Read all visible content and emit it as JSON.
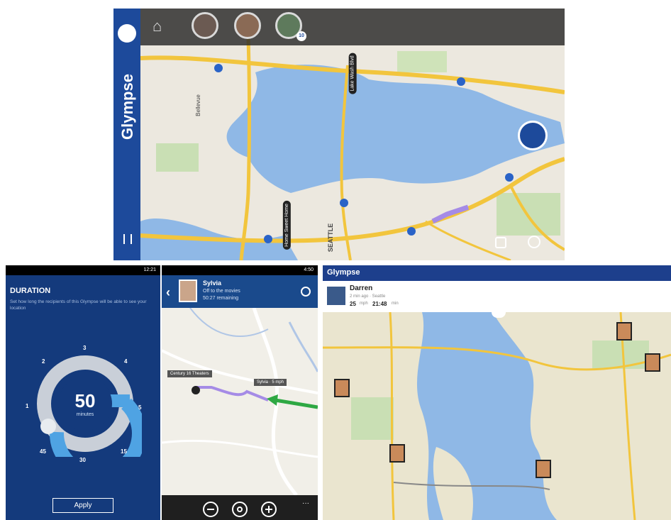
{
  "panel1": {
    "brand": "Glympse",
    "map_labels": [
      "Bellevue",
      "SEATTLE"
    ],
    "pill_labels": [
      "Lake Wash Blvd",
      "Home Sweet Home"
    ],
    "badge_count": "10"
  },
  "panel2": {
    "status_time": "12:21",
    "title": "DURATION",
    "description": "Set how long the recipients of this Glympse will be able to see your location",
    "dial_numbers": [
      "2",
      "3",
      "4",
      "1",
      "5",
      "45",
      "15",
      "30"
    ],
    "value": "50",
    "unit": "minutes",
    "apply_label": "Apply"
  },
  "panel3": {
    "status_time": "4:50",
    "name": "Sylvia",
    "subtitle_line1": "Off to the movies",
    "subtitle_line2": "50:27 remaining",
    "callout_left": "Century 16 Theaters",
    "callout_right": "Sylvia · 5 mph"
  },
  "panel4": {
    "brand": "Glympse",
    "contact_name": "Darren",
    "contact_sub": "2 min ago · Seattle",
    "eta_value": "25",
    "eta_unit": "mph",
    "time_value": "21:48",
    "time_unit": "min"
  },
  "colors": {
    "brand_blue": "#1d4a9b",
    "dark_blue": "#143a7c",
    "route_purple": "#a58be6",
    "route_green": "#2ea843",
    "road_yellow": "#f2c53d",
    "water_blue": "#8fb8e6"
  }
}
